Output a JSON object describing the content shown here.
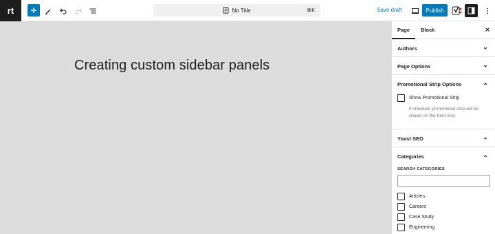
{
  "toolbar": {
    "logo_text": "rt",
    "document_title": "No Title",
    "shortcut": "⌘K",
    "save_draft": "Save draft",
    "publish": "Publish"
  },
  "editor": {
    "post_title": "Creating custom sidebar panels"
  },
  "sidebar": {
    "tabs": [
      {
        "label": "Page",
        "active": true
      },
      {
        "label": "Block",
        "active": false
      }
    ],
    "panels": {
      "authors": {
        "title": "Authors",
        "expanded": false
      },
      "page_options": {
        "title": "Page Options",
        "expanded": false
      },
      "promotional_strip": {
        "title": "Promotional Strip Options",
        "expanded": true,
        "checkbox_label": "Show Promotional Strip",
        "checked": false,
        "help": "If checked, promotional strip will be shown on the front end."
      },
      "yoast": {
        "title": "Yoast SEO",
        "expanded": false
      },
      "categories": {
        "title": "Categories",
        "expanded": true,
        "search_label": "SEARCH CATEGORIES",
        "search_value": "",
        "items": [
          {
            "label": "Articles",
            "checked": false
          },
          {
            "label": "Careers",
            "checked": false
          },
          {
            "label": "Case Study",
            "checked": false
          },
          {
            "label": "Engineering",
            "checked": false
          }
        ]
      }
    }
  },
  "colors": {
    "accent": "#007cba",
    "dark": "#1e1e1e",
    "canvas": "#dcdcdc",
    "muted": "#757575"
  }
}
